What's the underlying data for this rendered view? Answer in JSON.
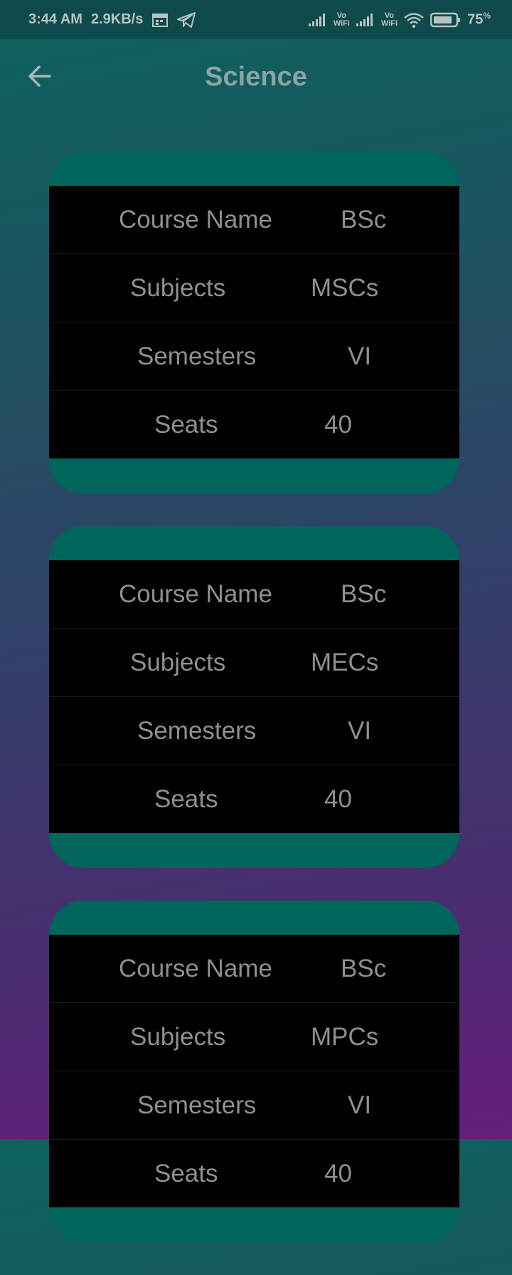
{
  "status_bar": {
    "time": "3:44 AM",
    "network_speed": "2.9KB/s",
    "battery_percent": "75",
    "battery_unit": "%",
    "volte_1": "Vo\nWiFi",
    "volte_2": "Vo\nWiFi",
    "icons": [
      "calendar-icon",
      "telegram-icon",
      "signal-icon",
      "volte-wifi-icon",
      "signal-icon",
      "volte-wifi-icon",
      "wifi-icon",
      "battery-icon"
    ]
  },
  "app_bar": {
    "title": "Science",
    "back_icon": "arrow-left-icon"
  },
  "colors": {
    "card_header": "#00665c",
    "table_bg": "#000000",
    "text": "#8f8f8f",
    "title": "#8aa3a3"
  },
  "courses": [
    {
      "rows": [
        {
          "label": "Course Name",
          "value": "BSc"
        },
        {
          "label": "Subjects",
          "value": "MSCs"
        },
        {
          "label": "Semesters",
          "value": "VI"
        },
        {
          "label": "Seats",
          "value": "40"
        }
      ]
    },
    {
      "rows": [
        {
          "label": "Course Name",
          "value": "BSc"
        },
        {
          "label": "Subjects",
          "value": "MECs"
        },
        {
          "label": "Semesters",
          "value": "VI"
        },
        {
          "label": "Seats",
          "value": "40"
        }
      ]
    },
    {
      "rows": [
        {
          "label": "Course Name",
          "value": "BSc"
        },
        {
          "label": "Subjects",
          "value": "MPCs"
        },
        {
          "label": "Semesters",
          "value": "VI"
        },
        {
          "label": "Seats",
          "value": "40"
        }
      ]
    }
  ]
}
